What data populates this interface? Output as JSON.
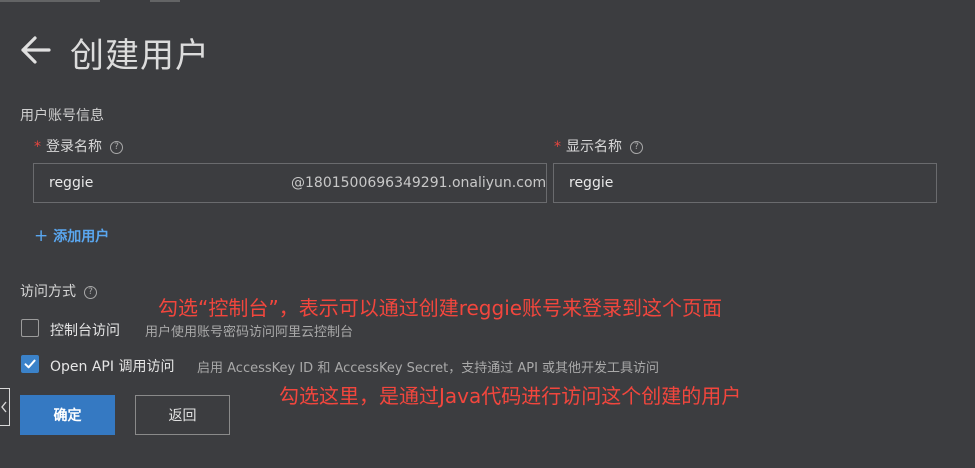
{
  "header": {
    "title": "创建用户",
    "back_icon": "arrow-left-icon"
  },
  "user_info": {
    "section_title": "用户账号信息",
    "login_name": {
      "label": "登录名称",
      "required_mark": "*",
      "help_glyph": "?",
      "value": "reggie",
      "suffix": "@1801500696349291.onaliyun.com"
    },
    "display_name": {
      "label": "显示名称",
      "required_mark": "*",
      "help_glyph": "?",
      "value": "reggie"
    },
    "add_user": {
      "plus": "+",
      "label": "添加用户"
    }
  },
  "access": {
    "label": "访问方式",
    "help_glyph": "?",
    "console": {
      "label": "控制台访问",
      "desc": "用户使用账号密码访问阿里云控制台",
      "checked": false
    },
    "api": {
      "label": "Open API 调用访问",
      "desc": "启用 AccessKey ID 和 AccessKey Secret，支持通过 API 或其他开发工具访问",
      "checked": true
    }
  },
  "annotations": {
    "console_note": "勾选“控制台”，表示可以通过创建reggie账号来登录到这个页面",
    "api_note": "勾选这里，是通过Java代码进行访问这个创建的用户"
  },
  "actions": {
    "confirm": "确定",
    "back": "返回"
  },
  "colors": {
    "background": "#3c3d40",
    "primary": "#3579c2",
    "link": "#5aa7f0",
    "annotation": "#f2463d",
    "required": "#e8463f"
  }
}
